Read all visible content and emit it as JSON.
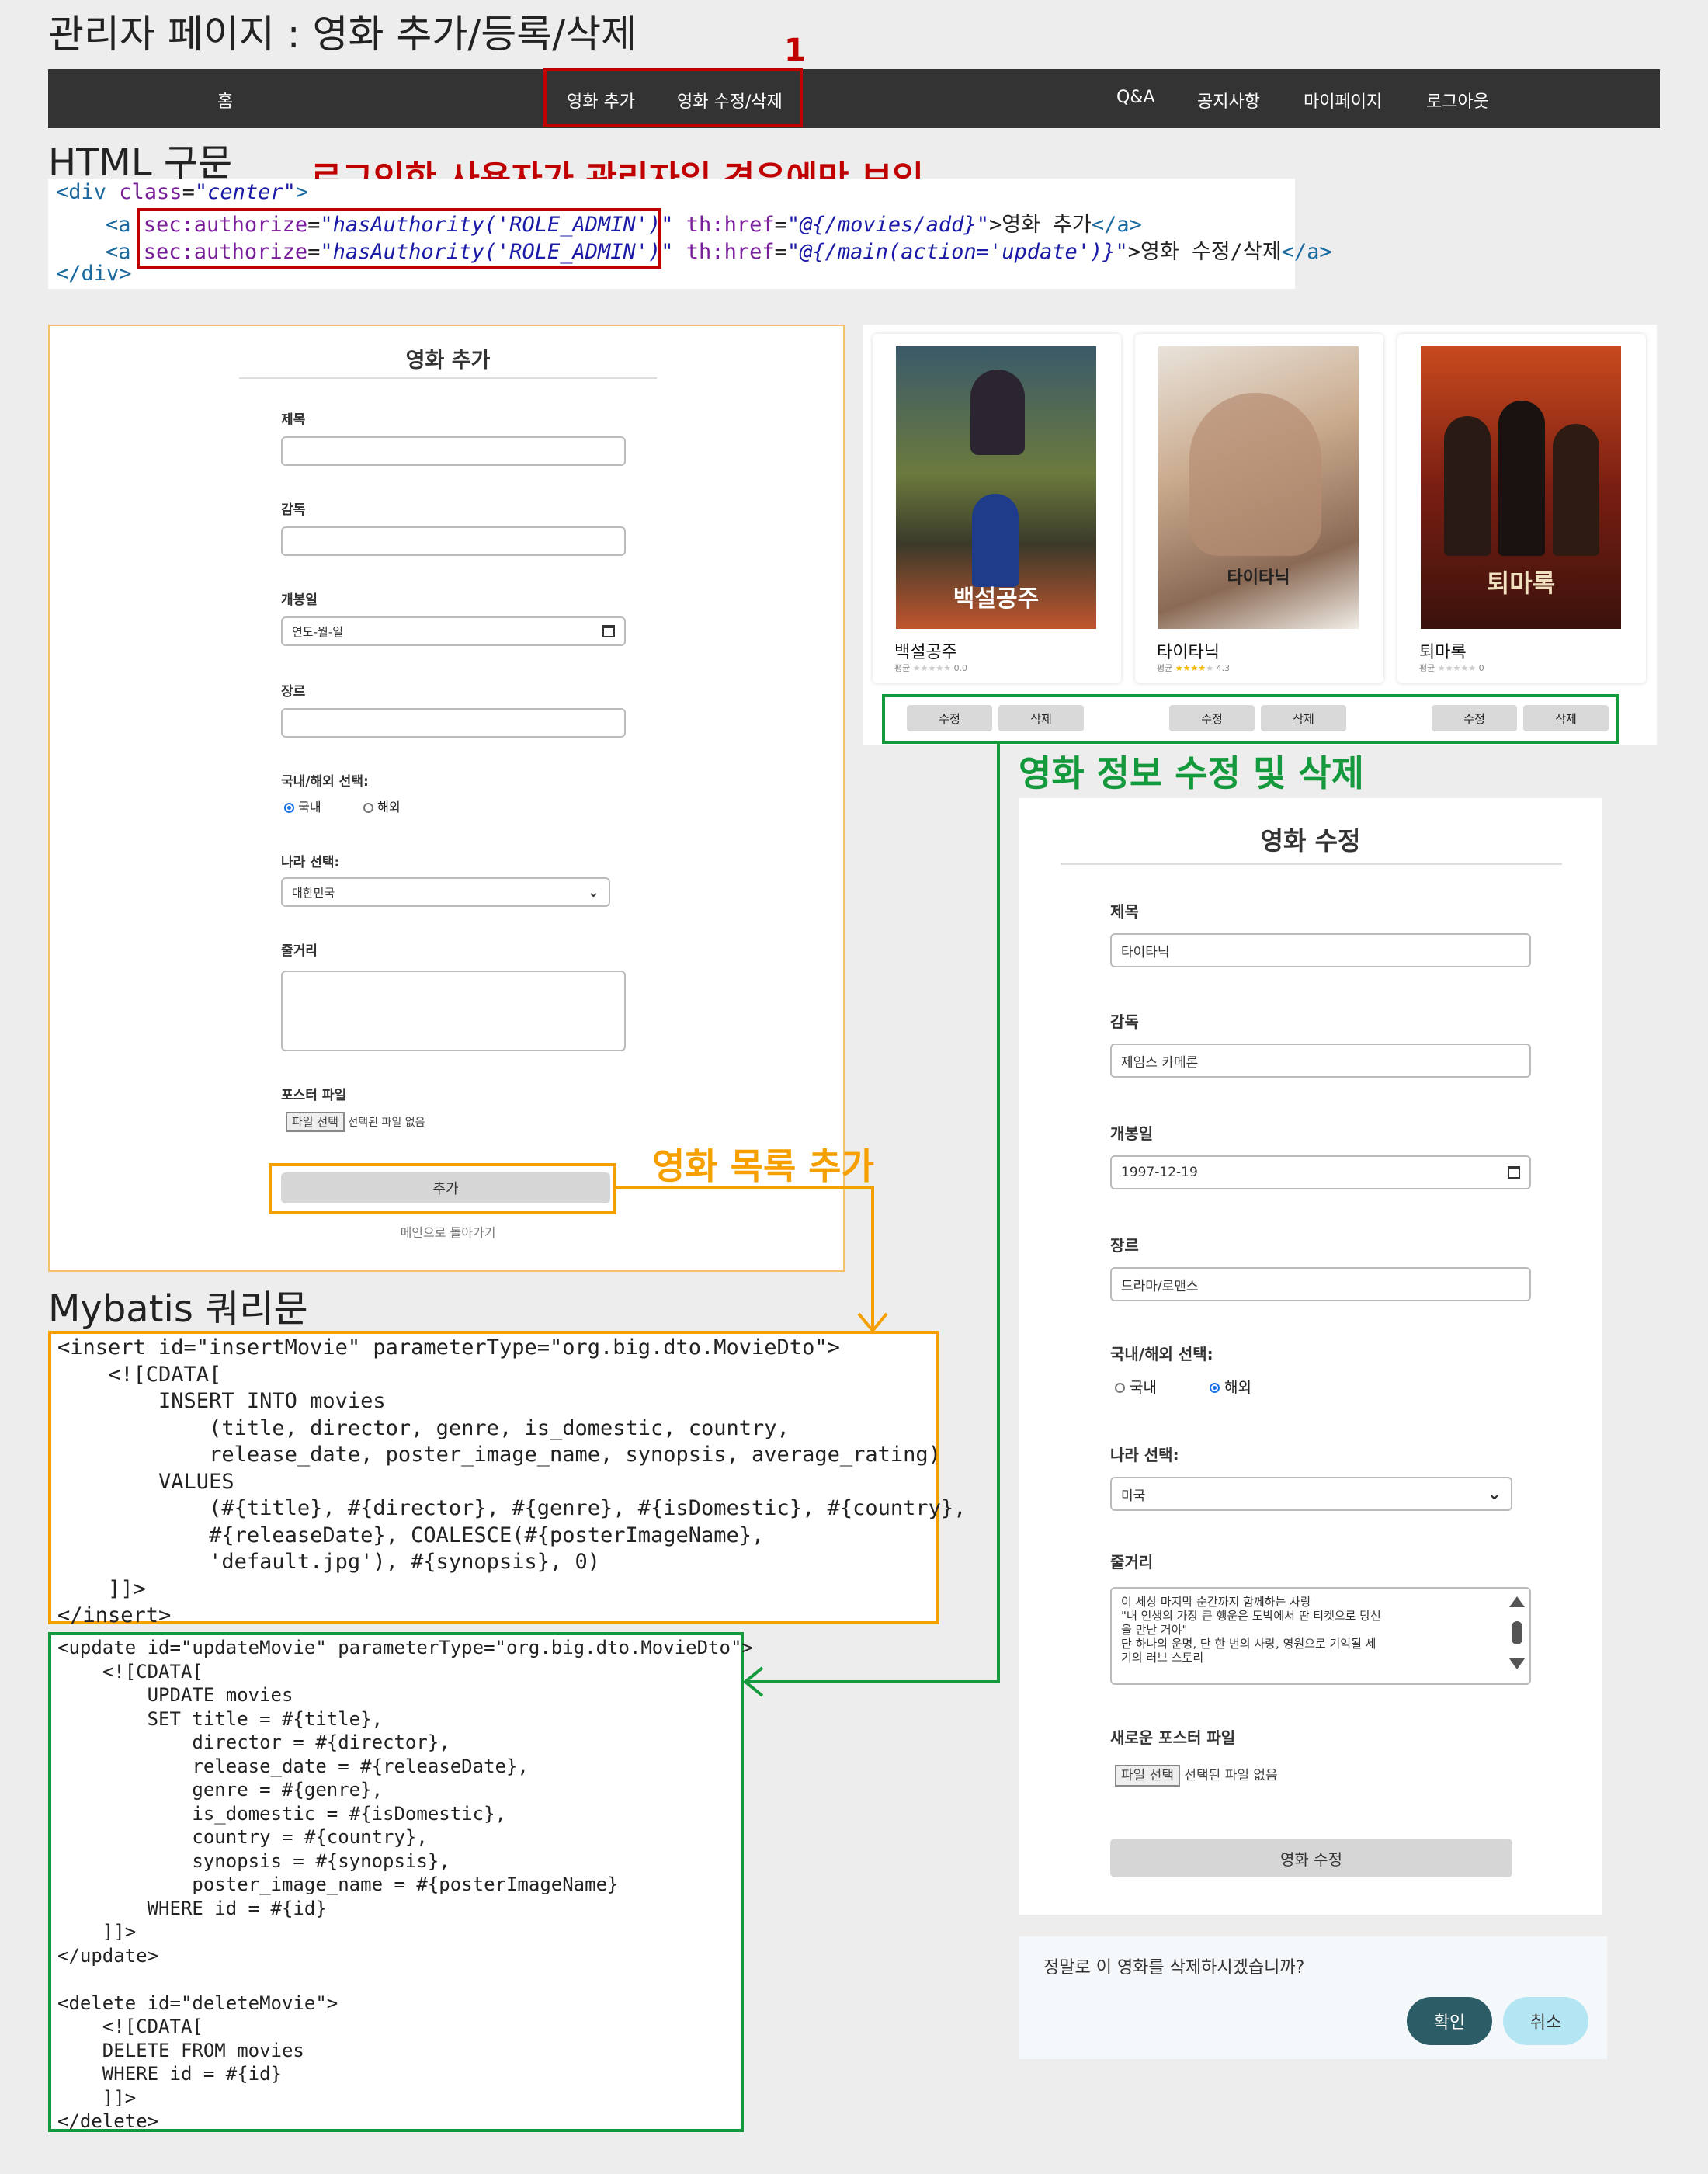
{
  "page_title": "관리자 페이지 : 영화 추가/등록/삭제",
  "marker_number": "1",
  "nav": {
    "home": "홈",
    "add_movie": "영화 추가",
    "edit_delete": "영화 수정/삭제",
    "qna": "Q&A",
    "notice": "공지사항",
    "mypage": "마이페이지",
    "logout": "로그아웃"
  },
  "html_section": {
    "heading": "HTML 구문",
    "note": "로그인한 사용자가 관리자일 경우에만 보임",
    "line1": {
      "open": "<div ",
      "attr": "class",
      "eq": "=",
      "val": "\"center\"",
      "close": ">"
    },
    "line2": {
      "open": "<a ",
      "attr": "sec:authorize",
      "val": "\"hasAuthority('ROLE_ADMIN')\"",
      "attr2": "th:href",
      "val2": "\"@{/movies/add}\"",
      "text": ">영화 추가",
      "end": "</a>"
    },
    "line3": {
      "open": "<a ",
      "attr": "sec:authorize",
      "val": "\"hasAuthority('ROLE_ADMIN')\"",
      "attr2": "th:href",
      "val2": "\"@{/main(action='update')}\"",
      "text": ">영화 수정/삭제",
      "end": "</a>"
    },
    "line4": "</div>"
  },
  "add_form": {
    "title": "영화 추가",
    "title_label": "제목",
    "director_label": "감독",
    "release_label": "개봉일",
    "release_placeholder": "연도-월-일",
    "genre_label": "장르",
    "domestic_label": "국내/해외 선택:",
    "radio_domestic": "국내",
    "radio_foreign": "해외",
    "country_label": "나라 선택:",
    "country_value": "대한민국",
    "synopsis_label": "줄거리",
    "poster_label": "포스터 파일",
    "file_button": "파일 선택",
    "file_none": "선택된 파일 없음",
    "submit": "추가",
    "back_link": "메인으로 돌아가기"
  },
  "movie_cards": [
    {
      "name": "백설공주",
      "rating_label": "평균",
      "rating": "0.0",
      "stars": 0,
      "edit": "수정",
      "delete": "삭제",
      "poster_caption": "백설공주"
    },
    {
      "name": "타이타닉",
      "rating_label": "평균",
      "rating": "4.3",
      "stars": 4,
      "edit": "수정",
      "delete": "삭제",
      "poster_caption": "타이타닉"
    },
    {
      "name": "퇴마록",
      "rating_label": "평균",
      "rating": "0",
      "stars": 0,
      "edit": "수정",
      "delete": "삭제",
      "poster_caption": "퇴마록"
    }
  ],
  "orange_note": "영화 목록 추가",
  "green_note": "영화 정보 수정 및 삭제",
  "edit_form": {
    "title": "영화 수정",
    "title_label": "제목",
    "title_value": "타이타닉",
    "director_label": "감독",
    "director_value": "제임스 카메론",
    "release_label": "개봉일",
    "release_value": "1997-12-19",
    "genre_label": "장르",
    "genre_value": "드라마/로맨스",
    "domestic_label": "국내/해외 선택:",
    "radio_domestic": "국내",
    "radio_foreign": "해외",
    "country_label": "나라 선택:",
    "country_value": "미국",
    "synopsis_label": "줄거리",
    "synopsis_lines": [
      "이 세상 마지막 순간까지 함께하는 사랑",
      "\"내 인생의 가장 큰 행운은 도박에서 딴 티켓으로 당신",
      "을 만난 거야\"",
      "단 하나의 운명, 단 한 번의 사랑, 영원으로 기억될 세",
      "기의 러브 스토리"
    ],
    "poster_label": "새로운 포스터 파일",
    "file_button": "파일 선택",
    "file_none": "선택된 파일 없음",
    "submit": "영화 수정"
  },
  "confirm_dialog": {
    "message": "정말로 이 영화를 삭제하시겠습니까?",
    "ok": "확인",
    "cancel": "취소"
  },
  "mybatis_heading": "Mybatis 쿼리문",
  "insert_sql": [
    "<insert id=\"insertMovie\" parameterType=\"org.big.dto.MovieDto\">",
    "    <![CDATA[",
    "        INSERT INTO movies",
    "            (title, director, genre, is_domestic, country,",
    "            release_date, poster_image_name, synopsis, average_rating)",
    "        VALUES",
    "            (#{title}, #{director}, #{genre}, #{isDomestic}, #{country},",
    "            #{releaseDate}, COALESCE(#{posterImageName},",
    "            'default.jpg'), #{synopsis}, 0)",
    "    ]]>",
    "</insert>"
  ],
  "update_sql": [
    "<update id=\"updateMovie\" parameterType=\"org.big.dto.MovieDto\">",
    "    <![CDATA[",
    "        UPDATE movies",
    "        SET title = #{title},",
    "            director = #{director},",
    "            release_date = #{releaseDate},",
    "            genre = #{genre},",
    "            is_domestic = #{isDomestic},",
    "            country = #{country},",
    "            synopsis = #{synopsis},",
    "            poster_image_name = #{posterImageName}",
    "        WHERE id = #{id}",
    "    ]]>",
    "</update>",
    "",
    "<delete id=\"deleteMovie\">",
    "    <![CDATA[",
    "    DELETE FROM movies",
    "    WHERE id = #{id}",
    "    ]]>",
    "</delete>"
  ],
  "colors": {
    "red": "#c00000",
    "orange": "#f5a000",
    "green": "#149a3c",
    "nav_bg": "#333333"
  }
}
